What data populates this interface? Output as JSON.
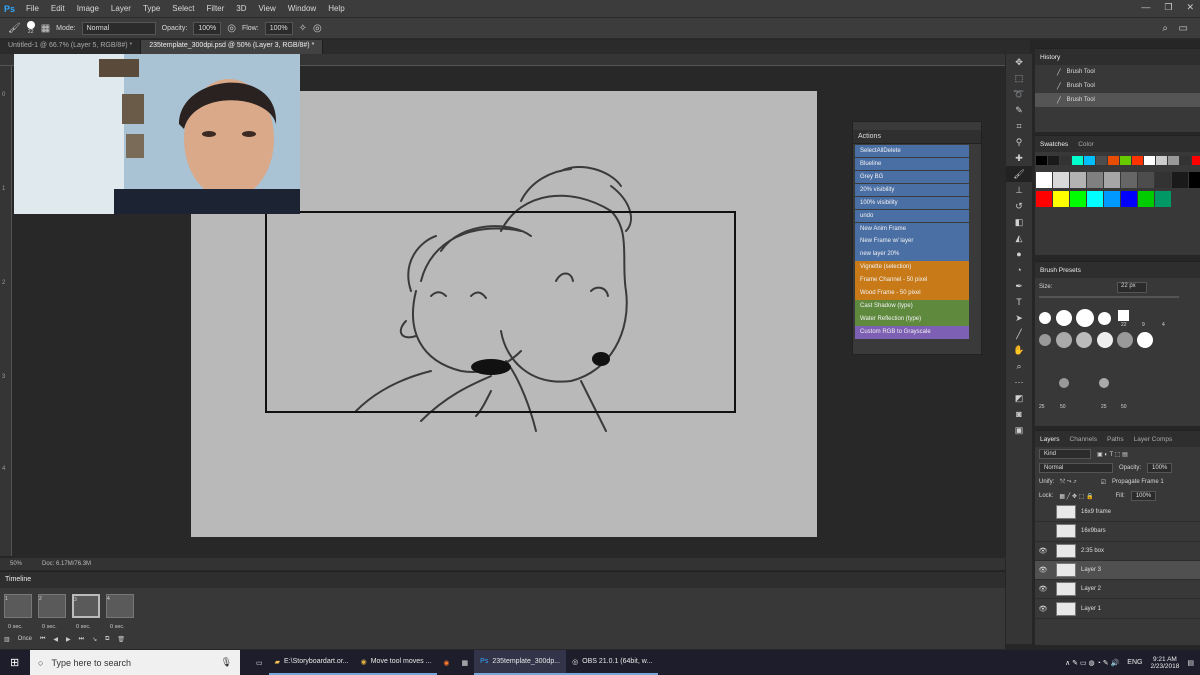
{
  "menubar": {
    "logo": "Ps",
    "items": [
      "File",
      "Edit",
      "Image",
      "Layer",
      "Type",
      "Select",
      "Filter",
      "3D",
      "View",
      "Window",
      "Help"
    ]
  },
  "options": {
    "mode_label": "Mode:",
    "mode_value": "Normal",
    "opacity_label": "Opacity:",
    "opacity_value": "100%",
    "flow_label": "Flow:",
    "flow_value": "100%",
    "brush_size": "22"
  },
  "tabs": [
    {
      "label": "Untitled-1 @ 66.7% (Layer 5, RGB/8#) *",
      "active": false
    },
    {
      "label": "235template_300dpi.psd @ 50% (Layer 3, RGB/8#) *",
      "active": true
    }
  ],
  "ruler": {
    "left_ticks": [
      "0",
      "1",
      "2",
      "3",
      "4"
    ]
  },
  "statusbar": {
    "zoom": "50%",
    "doc": "Doc: 6.17M/76.3M"
  },
  "actions": {
    "title": "Actions",
    "items": [
      {
        "label": "SelectAllDelete",
        "color": "#4a6fa5"
      },
      {
        "label": "Blueline",
        "color": "#4a6fa5"
      },
      {
        "label": "Grey BG",
        "color": "#4a6fa5"
      },
      {
        "label": "20% visibility",
        "color": "#4a6fa5"
      },
      {
        "label": "100% visibility",
        "color": "#4a6fa5"
      },
      {
        "label": "undo",
        "color": "#4a6fa5"
      },
      {
        "label": "New Anim Frame",
        "color": "#4a6fa5"
      },
      {
        "label": "New  Frame w/ layer",
        "color": "#4a6fa5"
      },
      {
        "label": "new layer 20%",
        "color": "#4a6fa5"
      },
      {
        "label": "Vignette (selection)",
        "color": "#c77a17"
      },
      {
        "label": "Frame Channel - 50 pixel",
        "color": "#c77a17"
      },
      {
        "label": "Wood Frame - 50 pixel",
        "color": "#c77a17"
      },
      {
        "label": "Cast Shadow (type)",
        "color": "#5f8a3e"
      },
      {
        "label": "Water Reflection (type)",
        "color": "#5f8a3e"
      },
      {
        "label": "Custom RGB to Grayscale",
        "color": "#7d5fb3"
      }
    ]
  },
  "history": {
    "title": "History",
    "items": [
      {
        "label": "Brush Tool",
        "selected": false
      },
      {
        "label": "Brush Tool",
        "selected": false
      },
      {
        "label": "Brush Tool",
        "selected": true
      }
    ]
  },
  "swatches": {
    "tabs": [
      "Swatches",
      "Color"
    ],
    "row1": [
      "#000000",
      "#1a1a1a",
      "#333333",
      "#00ffcc",
      "#00bfff",
      "#4d4d4d",
      "#e64d00",
      "#66cc00",
      "#ff3300",
      "#ffffff",
      "#cccccc",
      "#999999",
      "#333333",
      "#ff0000"
    ],
    "row2": [
      "#ffffff",
      "#d9d9d9",
      "#b3b3b3",
      "#808080",
      "#a6a6a6",
      "#666666",
      "#4d4d4d",
      "#333333",
      "#1a1a1a",
      "#000000"
    ],
    "row3": [
      "#ff0000",
      "#ffff00",
      "#00ff00",
      "#00ffff",
      "#0099ff",
      "#0000ff",
      "#00cc00",
      "#009966"
    ]
  },
  "brushpresets": {
    "title": "Brush Presets",
    "size_label": "Size:",
    "size_value": "22 px",
    "numbers": [
      "22",
      "9",
      "4"
    ],
    "row_labels": [
      "25",
      "50",
      "25",
      "50"
    ]
  },
  "layers": {
    "tabs": [
      "Layers",
      "Channels",
      "Paths",
      "Layer Comps"
    ],
    "kind": "Kind",
    "blend": "Normal",
    "opacity_label": "Opacity:",
    "opacity_value": "100%",
    "unify_label": "Unify:",
    "propagate": "Propagate Frame 1",
    "lock_label": "Lock:",
    "fill_label": "Fill:",
    "fill_value": "100%",
    "items": [
      {
        "name": "16x9 frame",
        "visible": false,
        "selected": false
      },
      {
        "name": "16x9bars",
        "visible": false,
        "selected": false
      },
      {
        "name": "2:35 box",
        "visible": true,
        "selected": false
      },
      {
        "name": "Layer 3",
        "visible": true,
        "selected": true
      },
      {
        "name": "Layer 2",
        "visible": true,
        "selected": false
      },
      {
        "name": "Layer 1",
        "visible": true,
        "selected": false
      }
    ]
  },
  "timeline": {
    "title": "Timeline",
    "frames": [
      {
        "num": "1",
        "delay": "0 sec."
      },
      {
        "num": "2",
        "delay": "0 sec."
      },
      {
        "num": "3",
        "delay": "0 sec."
      },
      {
        "num": "4",
        "delay": "0 sec."
      }
    ],
    "loop": "Once"
  },
  "taskbar": {
    "search_placeholder": "Type here to search",
    "apps": [
      {
        "label": "E:\\Storyboardart.or...",
        "icon": "folder-icon"
      },
      {
        "label": "Move tool moves ...",
        "icon": "chrome-icon"
      },
      {
        "label": "",
        "icon": "firefox-icon"
      },
      {
        "label": "",
        "icon": "calculator-icon"
      },
      {
        "label": "235template_300dp...",
        "icon": "photoshop-icon"
      },
      {
        "label": "OBS 21.0.1 (64bit, w...",
        "icon": "obs-icon"
      }
    ],
    "lang": "ENG",
    "time": "9:21 AM",
    "date": "2/23/2018"
  }
}
